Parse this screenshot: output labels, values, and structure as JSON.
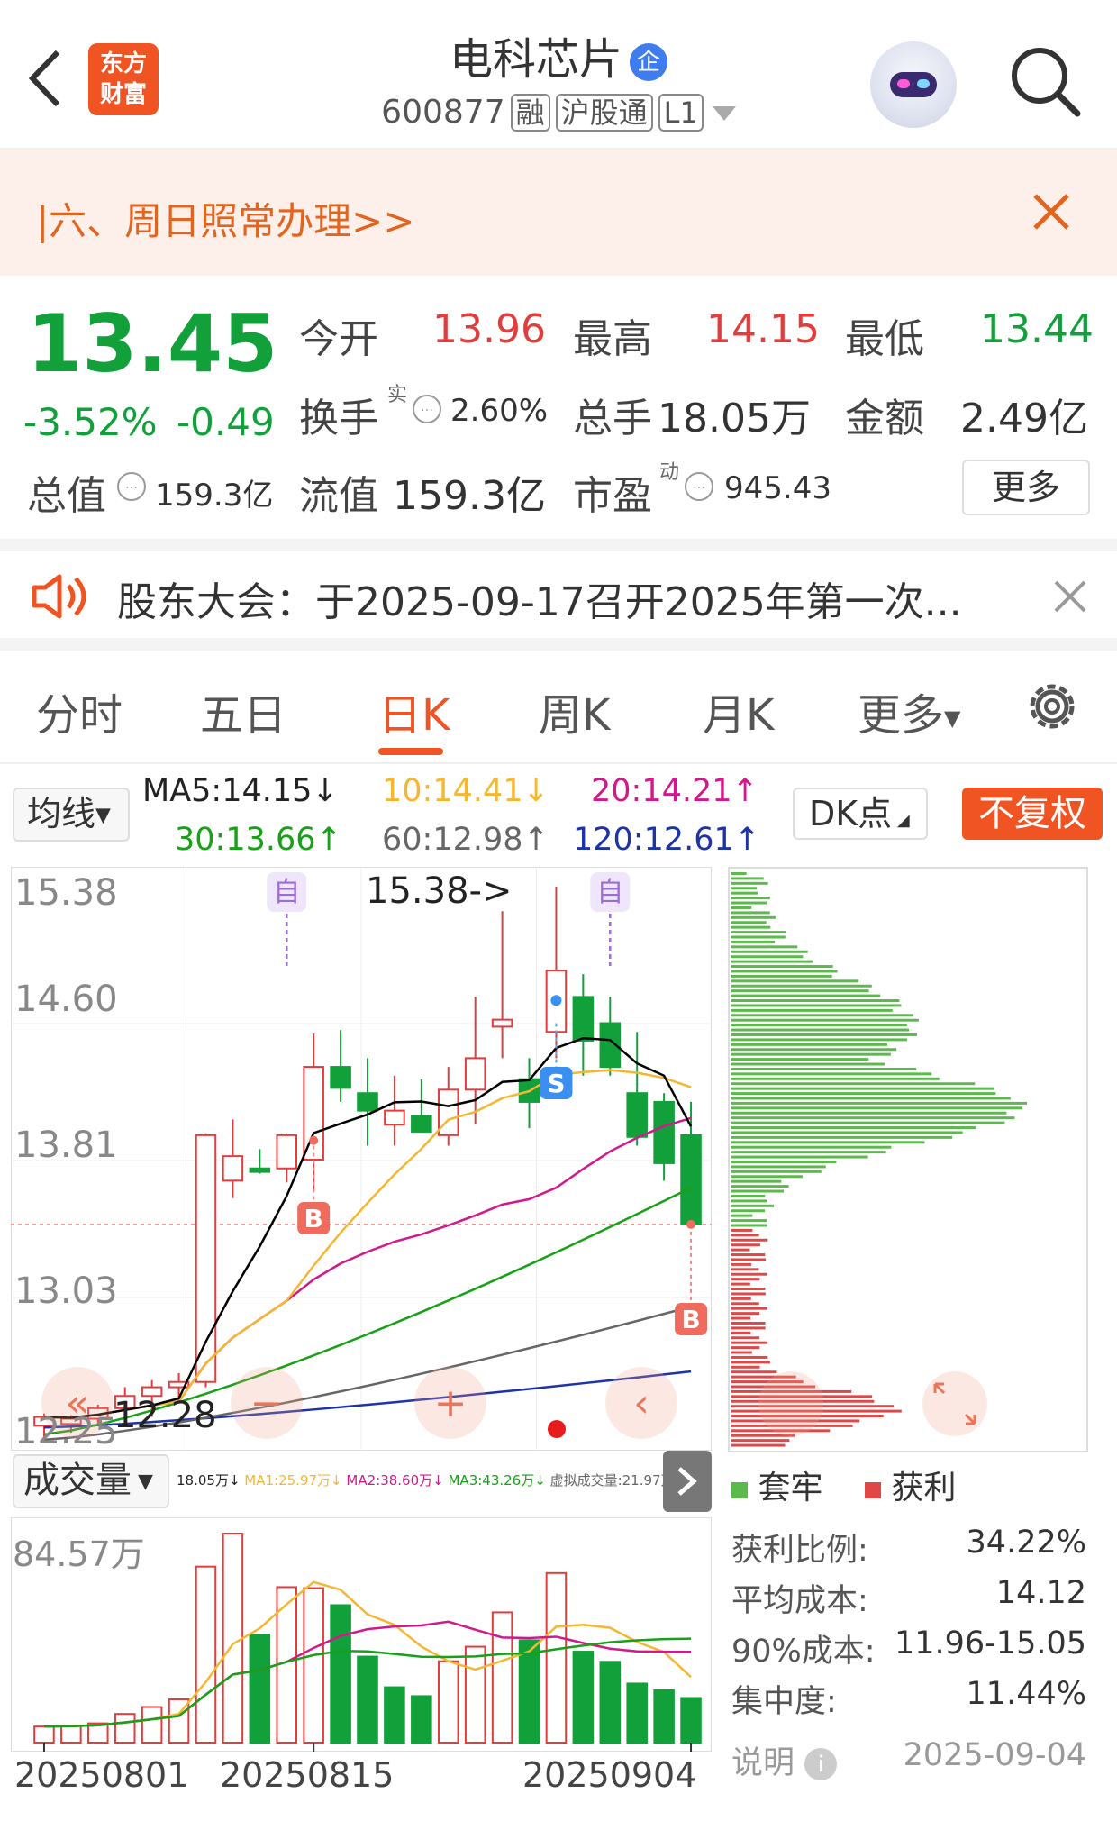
{
  "header": {
    "stock_name": "电科芯片",
    "stock_tag": "企",
    "logo_text_line1": "东方",
    "logo_text_line2": "财富",
    "code": "600877",
    "badges": [
      "融",
      "沪股通",
      "L1"
    ]
  },
  "banner": {
    "text": "|六、周日照常办理>>"
  },
  "quote": {
    "price": "13.45",
    "change_pct": "-3.52%",
    "change": "-0.49",
    "open_label": "今开",
    "open_value": "13.96",
    "high_label": "最高",
    "high_value": "14.15",
    "low_label": "最低",
    "low_value": "13.44",
    "turnover_label": "换手",
    "turnover_sup": "实",
    "turnover_value": "2.60%",
    "volume_label": "总手",
    "volume_value": "18.05万",
    "amount_label": "金额",
    "amount_value": "2.49亿",
    "mktcap_label": "总值",
    "mktcap_value": "159.3亿",
    "float_label": "流值",
    "float_value": "159.3亿",
    "pe_label": "市盈",
    "pe_sup": "动",
    "pe_value": "945.43",
    "more_label": "更多",
    "info_icon": "…"
  },
  "notice": {
    "text": "股东大会：于2025-09-17召开2025年第一次..."
  },
  "tabs": [
    "分时",
    "五日",
    "日K",
    "周K",
    "月K",
    "更多"
  ],
  "active_tab": "日K",
  "ma_panel": {
    "selector": "均线",
    "ma5": "MA5:14.15↓",
    "ma10": "10:14.41↓",
    "ma20": "20:14.21↑",
    "ma30": "30:13.66↑",
    "ma60": "60:12.98↑",
    "ma120": "120:12.61↑",
    "dk_label": "DK点",
    "fuquan_label": "不复权"
  },
  "kline": {
    "y_labels": [
      "15.38",
      "14.60",
      "13.81",
      "13.03",
      "12.25"
    ],
    "high_annotation": "15.38->",
    "low_annotation": "12.28",
    "marker_zi": "自",
    "marker_b": "B",
    "marker_s": "S"
  },
  "volume_panel": {
    "selector": "成交量",
    "info_total": "18.05万↓",
    "info_ma1": "MA1:25.97万↓",
    "info_ma2": "MA2:38.60万↓",
    "info_ma3": "MA3:43.26万↓",
    "info_virtual": "虚拟成交量:21.97万",
    "max_label": "84.57万",
    "dates": [
      "20250801",
      "20250815",
      "20250904"
    ]
  },
  "chip": {
    "legend_trapped": "套牢",
    "legend_profit": "获利",
    "profit_ratio_label": "获利比例:",
    "profit_ratio_value": "34.22%",
    "avg_cost_label": "平均成本:",
    "avg_cost_value": "14.12",
    "cost90_label": "90%成本:",
    "cost90_value": "11.96-15.05",
    "concentration_label": "集中度:",
    "concentration_value": "11.44%",
    "explain_label": "说明",
    "date": "2025-09-04"
  },
  "colors": {
    "up": "#e23c3c",
    "down": "#12a03b",
    "brand": "#f05423",
    "ma5": "#000000",
    "ma10": "#f5b731",
    "ma20": "#d1198c",
    "ma30": "#16a116",
    "ma60": "#666666",
    "ma120": "#1d33a8"
  },
  "chart_data": {
    "type": "candlestick",
    "price_range": [
      12.25,
      15.38
    ],
    "candles": [
      {
        "o": 12.3,
        "h": 12.37,
        "l": 12.2,
        "c": 12.35
      },
      {
        "o": 12.31,
        "h": 12.36,
        "l": 12.26,
        "c": 12.34
      },
      {
        "o": 12.34,
        "h": 12.42,
        "l": 12.3,
        "c": 12.4
      },
      {
        "o": 12.4,
        "h": 12.52,
        "l": 12.34,
        "c": 12.47
      },
      {
        "o": 12.47,
        "h": 12.56,
        "l": 12.35,
        "c": 12.52
      },
      {
        "o": 12.52,
        "h": 12.6,
        "l": 12.43,
        "c": 12.55
      },
      {
        "o": 12.55,
        "h": 13.97,
        "l": 12.52,
        "c": 13.96
      },
      {
        "o": 13.7,
        "h": 14.05,
        "l": 13.6,
        "c": 13.84
      },
      {
        "o": 13.77,
        "h": 13.88,
        "l": 13.74,
        "c": 13.75
      },
      {
        "o": 13.77,
        "h": 13.97,
        "l": 13.69,
        "c": 13.96
      },
      {
        "o": 13.82,
        "h": 14.54,
        "l": 13.64,
        "c": 14.35
      },
      {
        "o": 14.35,
        "h": 14.56,
        "l": 14.15,
        "c": 14.23
      },
      {
        "o": 14.2,
        "h": 14.4,
        "l": 13.9,
        "c": 14.1
      },
      {
        "o": 14.02,
        "h": 14.3,
        "l": 13.9,
        "c": 14.1
      },
      {
        "o": 14.07,
        "h": 14.28,
        "l": 13.98,
        "c": 13.98
      },
      {
        "o": 13.96,
        "h": 14.35,
        "l": 13.9,
        "c": 14.22
      },
      {
        "o": 14.22,
        "h": 14.75,
        "l": 14.02,
        "c": 14.4
      },
      {
        "o": 14.58,
        "h": 15.24,
        "l": 14.4,
        "c": 14.62
      },
      {
        "o": 14.28,
        "h": 14.4,
        "l": 14.0,
        "c": 14.15
      },
      {
        "o": 14.55,
        "h": 15.38,
        "l": 14.4,
        "c": 14.9
      },
      {
        "o": 14.75,
        "h": 14.88,
        "l": 14.3,
        "c": 14.5
      },
      {
        "o": 14.6,
        "h": 14.75,
        "l": 14.3,
        "c": 14.35
      },
      {
        "o": 14.2,
        "h": 14.55,
        "l": 13.9,
        "c": 13.95
      },
      {
        "o": 14.15,
        "h": 14.2,
        "l": 13.7,
        "c": 13.8
      },
      {
        "o": 13.96,
        "h": 14.15,
        "l": 13.44,
        "c": 13.45
      }
    ],
    "volumes": [
      6.5,
      6.8,
      7.8,
      11.6,
      14.4,
      17.5,
      71.2,
      84.57,
      43.7,
      62.9,
      62.5,
      55.6,
      34.8,
      22.4,
      18.8,
      32.9,
      38.8,
      52.7,
      41.4,
      68.6,
      36.8,
      32.7,
      23.9,
      21.2,
      18.05
    ],
    "vol_up": [
      true,
      true,
      true,
      true,
      true,
      true,
      true,
      true,
      false,
      true,
      true,
      false,
      false,
      false,
      false,
      true,
      true,
      true,
      false,
      true,
      false,
      false,
      false,
      false,
      false
    ],
    "x_dates": [
      "20250801",
      "20250815",
      "20250904"
    ]
  }
}
